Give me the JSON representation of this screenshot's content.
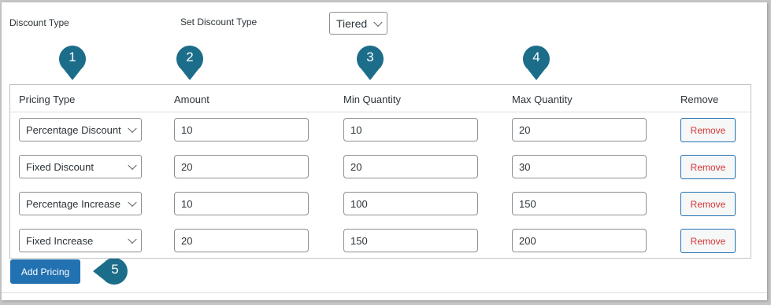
{
  "discount": {
    "label": "Discount Type",
    "set_label": "Set Discount Type",
    "selected": "Tiered"
  },
  "columns": [
    "Pricing Type",
    "Amount",
    "Min Quantity",
    "Max Quantity",
    "Remove"
  ],
  "rows": [
    {
      "pricing_type": "Percentage Discount",
      "amount": "10",
      "min": "10",
      "max": "20",
      "remove": "Remove"
    },
    {
      "pricing_type": "Fixed Discount",
      "amount": "20",
      "min": "20",
      "max": "30",
      "remove": "Remove"
    },
    {
      "pricing_type": "Percentage Increase",
      "amount": "10",
      "min": "100",
      "max": "150",
      "remove": "Remove"
    },
    {
      "pricing_type": "Fixed Increase",
      "amount": "20",
      "min": "150",
      "max": "200",
      "remove": "Remove"
    }
  ],
  "add_button": "Add Pricing",
  "callouts": [
    "1",
    "2",
    "3",
    "4",
    "5"
  ],
  "colors": {
    "accent": "#2271b1",
    "callout": "#1b6d8a",
    "remove_text": "#d63638"
  }
}
